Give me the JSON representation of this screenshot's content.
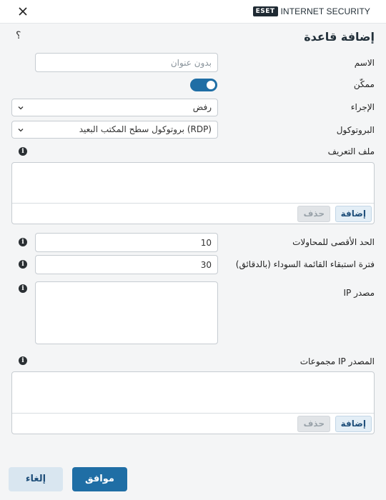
{
  "header": {
    "logo_text": "ESET",
    "product": "INTERNET SECURITY",
    "close_icon": "close-icon"
  },
  "dialog": {
    "title": "إضافة قاعدة",
    "help_glyph": "؟"
  },
  "fields": {
    "name": {
      "label": "الاسم",
      "placeholder": "بدون عنوان",
      "value": ""
    },
    "enabled": {
      "label": "ممكّن",
      "on": true
    },
    "action": {
      "label": "الإجراء",
      "value": "رفض"
    },
    "protocol": {
      "label": "البروتوكول",
      "value": "بروتوكول سطح المكتب البعيد (RDP)"
    },
    "profile": {
      "label": "ملف التعريف",
      "add_label": "إضافة",
      "delete_label": "حذف"
    },
    "max_attempts": {
      "label": "الحد الأقصى للمحاولات",
      "value": "10"
    },
    "blacklist_period": {
      "label": "فترة استبقاء القائمة السوداء (بالدقائق)",
      "value": "30"
    },
    "source_ip": {
      "label": "IP مصدر",
      "value": ""
    },
    "source_ip_groups": {
      "label": "مجموعات IP المصدر",
      "add_label": "إضافة",
      "delete_label": "حذف"
    }
  },
  "footer": {
    "ok_label": "موافق",
    "cancel_label": "إلغاء"
  },
  "colors": {
    "accent": "#1f6ea5",
    "background": "#f4f5f6"
  }
}
